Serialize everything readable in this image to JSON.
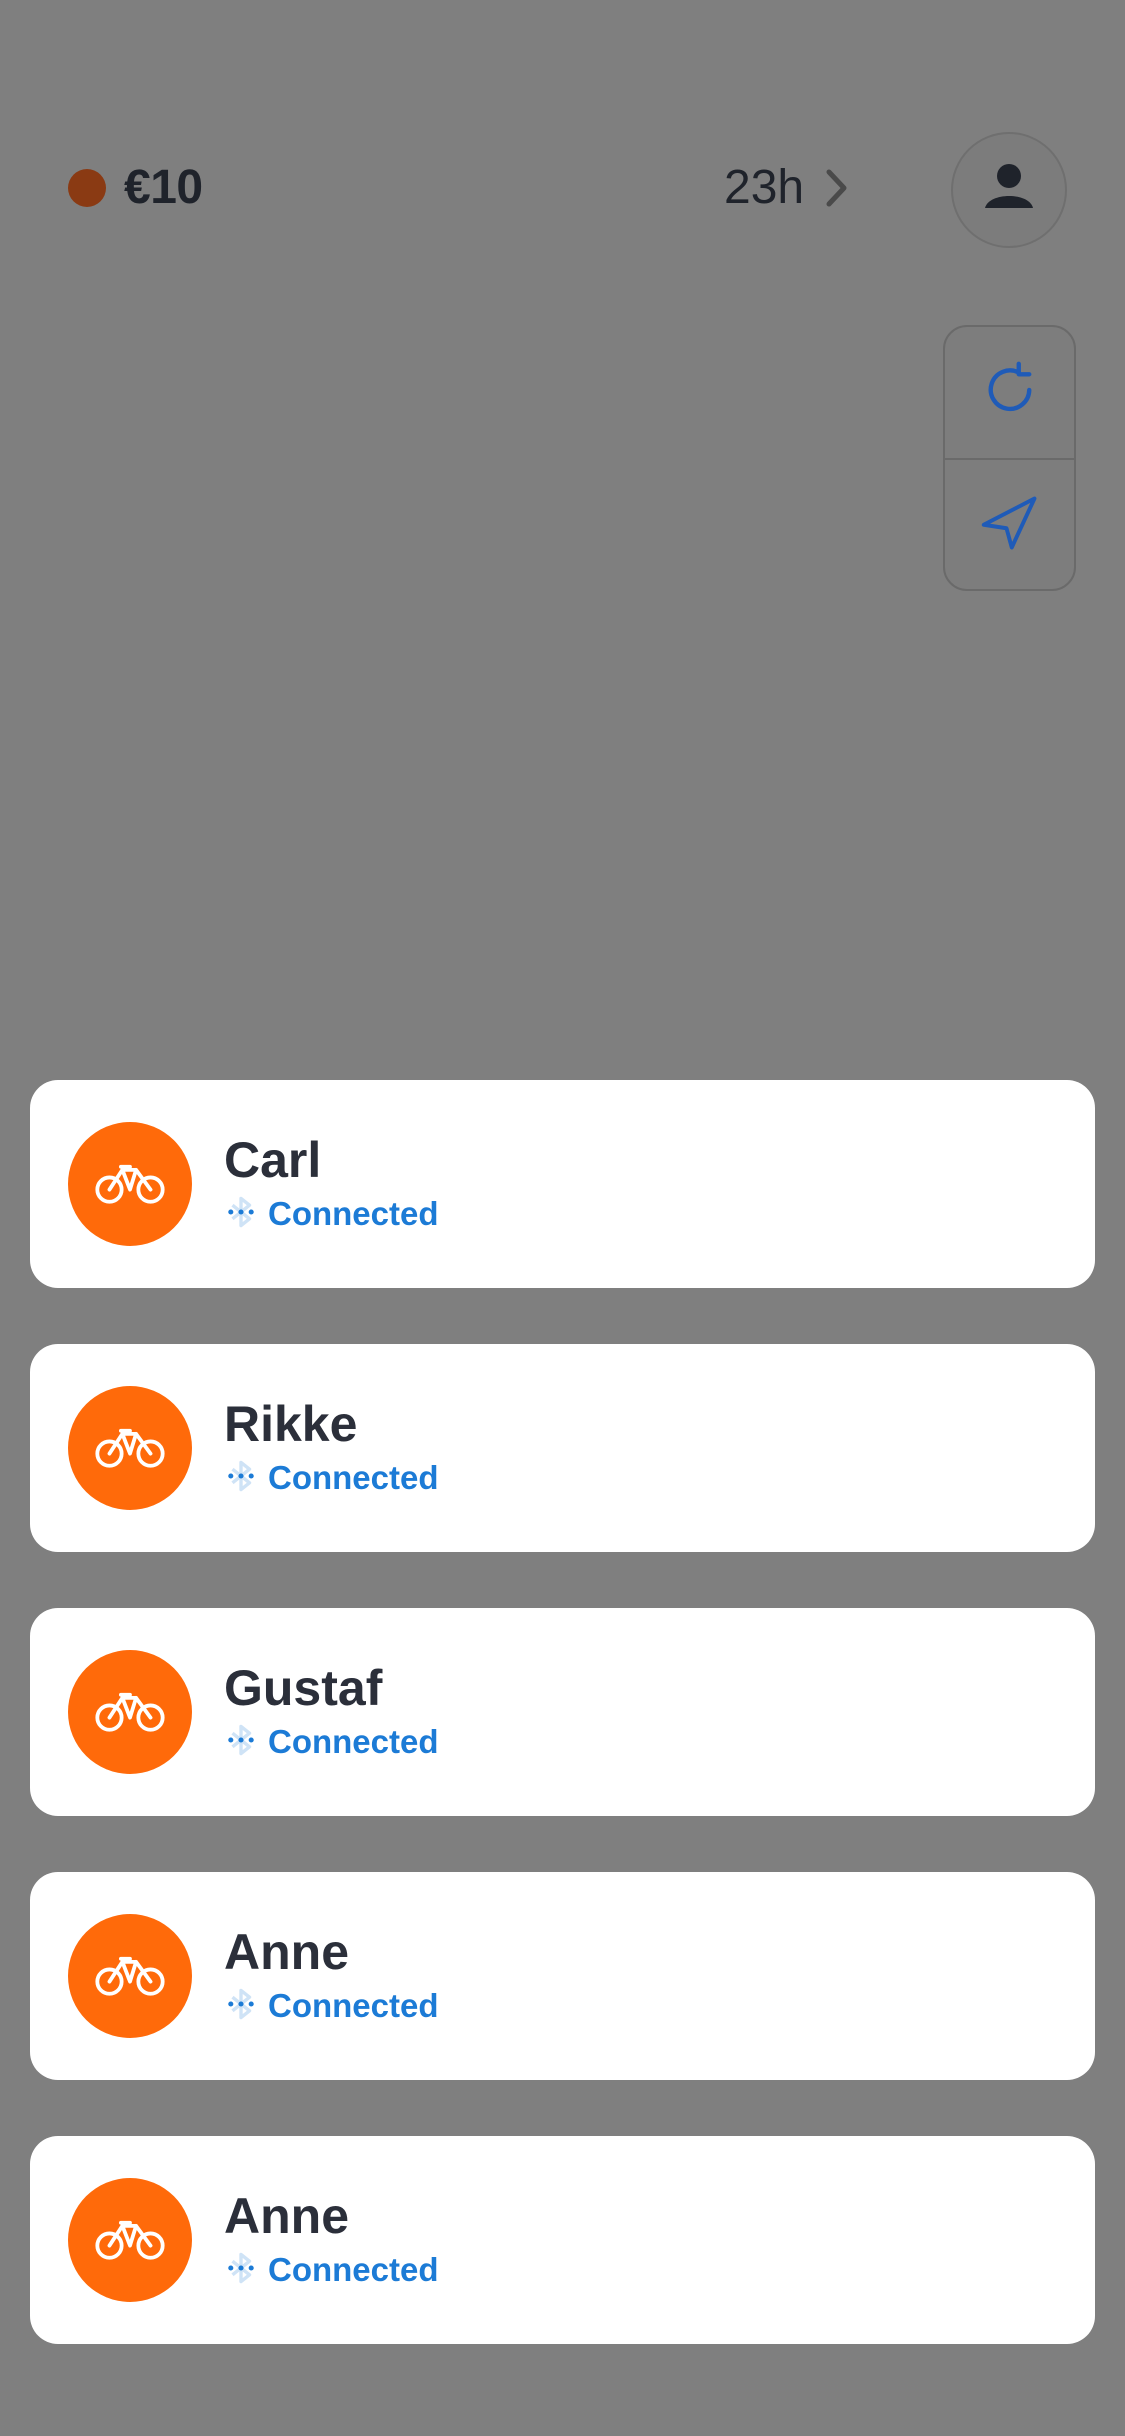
{
  "top_bar": {
    "balance": "€10",
    "balance_color": "#8a3a13",
    "time_left": "23h"
  },
  "devices": [
    {
      "name": "Carl",
      "status": "Connected"
    },
    {
      "name": "Rikke",
      "status": "Connected"
    },
    {
      "name": "Gustaf",
      "status": "Connected"
    },
    {
      "name": "Anne",
      "status": "Connected"
    },
    {
      "name": "Anne",
      "status": "Connected"
    }
  ],
  "colors": {
    "accent": "#ff6a0a",
    "status": "#1c7bd6",
    "overlay": "#7f7f7f"
  },
  "icons": {
    "profile": "person-icon",
    "refresh": "refresh-icon",
    "locate": "navigation-arrow-icon",
    "bike": "bicycle-icon",
    "bluetooth": "bluetooth-icon",
    "chevron": "chevron-right-icon"
  }
}
